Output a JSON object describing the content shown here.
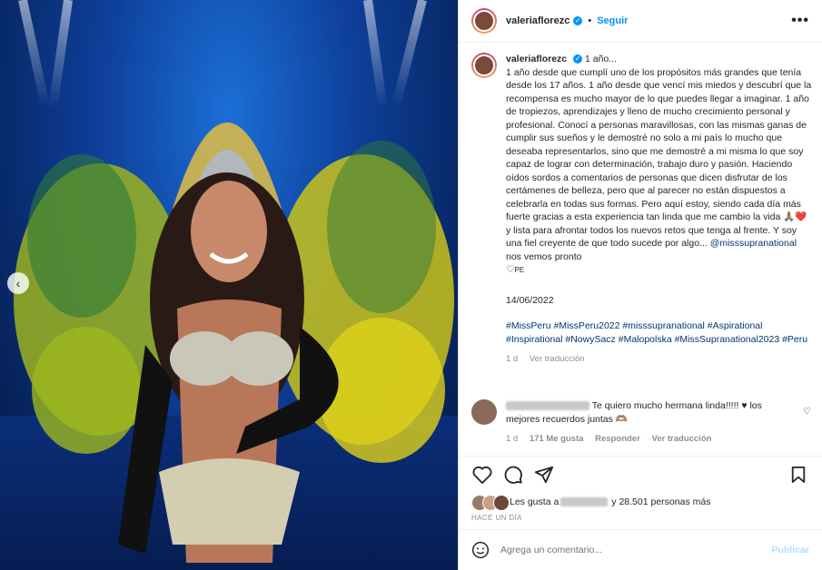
{
  "post": {
    "username": "valeriaflorezc",
    "follow_label": "Seguir",
    "more_label": "•••"
  },
  "caption": {
    "username": "valeriaflorezc",
    "title": "1 año...",
    "body": "1 año desde que cumplí uno de los propósitos más grandes que tenía desde los 17 años. 1 año desde que vencí mis miedos y descubrí que la recompensa es mucho mayor de lo que puedes llegar a imaginar. 1 año de tropiezos, aprendizajes y lleno de mucho crecimiento personal y profesional. Conocí a personas maravillosas, con las mismas ganas de cumplir sus sueños y le demostré no solo a mi país lo mucho que deseaba representarlos, sino que me demostré a mi misma lo que soy capaz de lograr con determinación, trabajo duro y pasión. Haciendo oídos sordos a comentarios de personas que dicen disfrutar de los certámenes de belleza, pero que al parecer no están dispuestos a celebrarla en todas sus formas. Pero aquí estoy, siendo cada día más fuerte gracias a esta experiencia tan linda que me cambio la vida 🙏🏽❤️ y lista para afrontar todos los nuevos retos que tenga al frente. Y soy una fiel creyente de que todo sucede por algo...",
    "mention": "@misssupranational",
    "closing": "nos vemos pronto",
    "closing_emoji": "♡",
    "closing_tag": "PE",
    "date": "14/06/2022",
    "hashtags": "#MissPeru #MissPeru2022 #misssupranational #Aspirational #Inspirational #NowySacz #Malopolska #MissSupranational2023 #Peru",
    "age": "1 d",
    "translate": "Ver traducción"
  },
  "comment": {
    "text": "Te quiero mucho hermana linda!!!!! ♥ los mejores recuerdos juntas 🫶🏽",
    "age": "1 d",
    "likes": "171 Me gusta",
    "reply": "Responder",
    "translate": "Ver traducción"
  },
  "likes": {
    "prefix": "Les gusta a",
    "suffix": "y 28.501 personas más"
  },
  "time_ago": "HACE UN DÍA",
  "add_comment": {
    "placeholder": "Agrega un comentario...",
    "publish": "Publicar"
  },
  "colors": {
    "accent": "#0095f6",
    "link": "#00376b",
    "muted": "#8e8e8e"
  }
}
